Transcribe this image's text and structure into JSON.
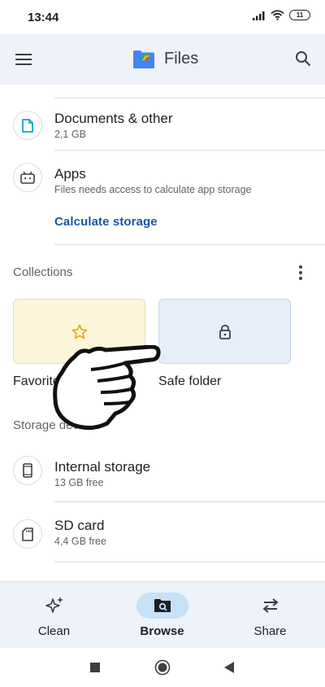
{
  "status": {
    "time": "13:44",
    "battery": "11"
  },
  "app_bar": {
    "title": "Files"
  },
  "storage_items": [
    {
      "title": "Documents & other",
      "subtitle": "2,1 GB",
      "icon": "document-icon"
    },
    {
      "title": "Apps",
      "subtitle": "Files needs access to calculate app storage",
      "icon": "android-icon"
    }
  ],
  "calculate_link": "Calculate storage",
  "collections": {
    "heading": "Collections",
    "favorites_label": "Favorites",
    "safe_folder_label": "Safe folder"
  },
  "storage_devices": {
    "heading": "Storage devices",
    "items": [
      {
        "title": "Internal storage",
        "subtitle": "13 GB free",
        "icon": "phone-icon"
      },
      {
        "title": "SD card",
        "subtitle": "4,4 GB free",
        "icon": "sd-card-icon"
      }
    ]
  },
  "bottom_nav": [
    {
      "label": "Clean",
      "icon": "sparkle-icon",
      "active": false
    },
    {
      "label": "Browse",
      "icon": "browse-icon",
      "active": true
    },
    {
      "label": "Share",
      "icon": "swap-arrows-icon",
      "active": false
    }
  ],
  "colors": {
    "app_bar_bg": "#eef2f9",
    "link": "#1a56a6",
    "favorites_tile": "#fdf5db",
    "safe_tile": "#e6eef9",
    "active_nav_pill": "#c6e0f5",
    "star": "#e6a700"
  }
}
